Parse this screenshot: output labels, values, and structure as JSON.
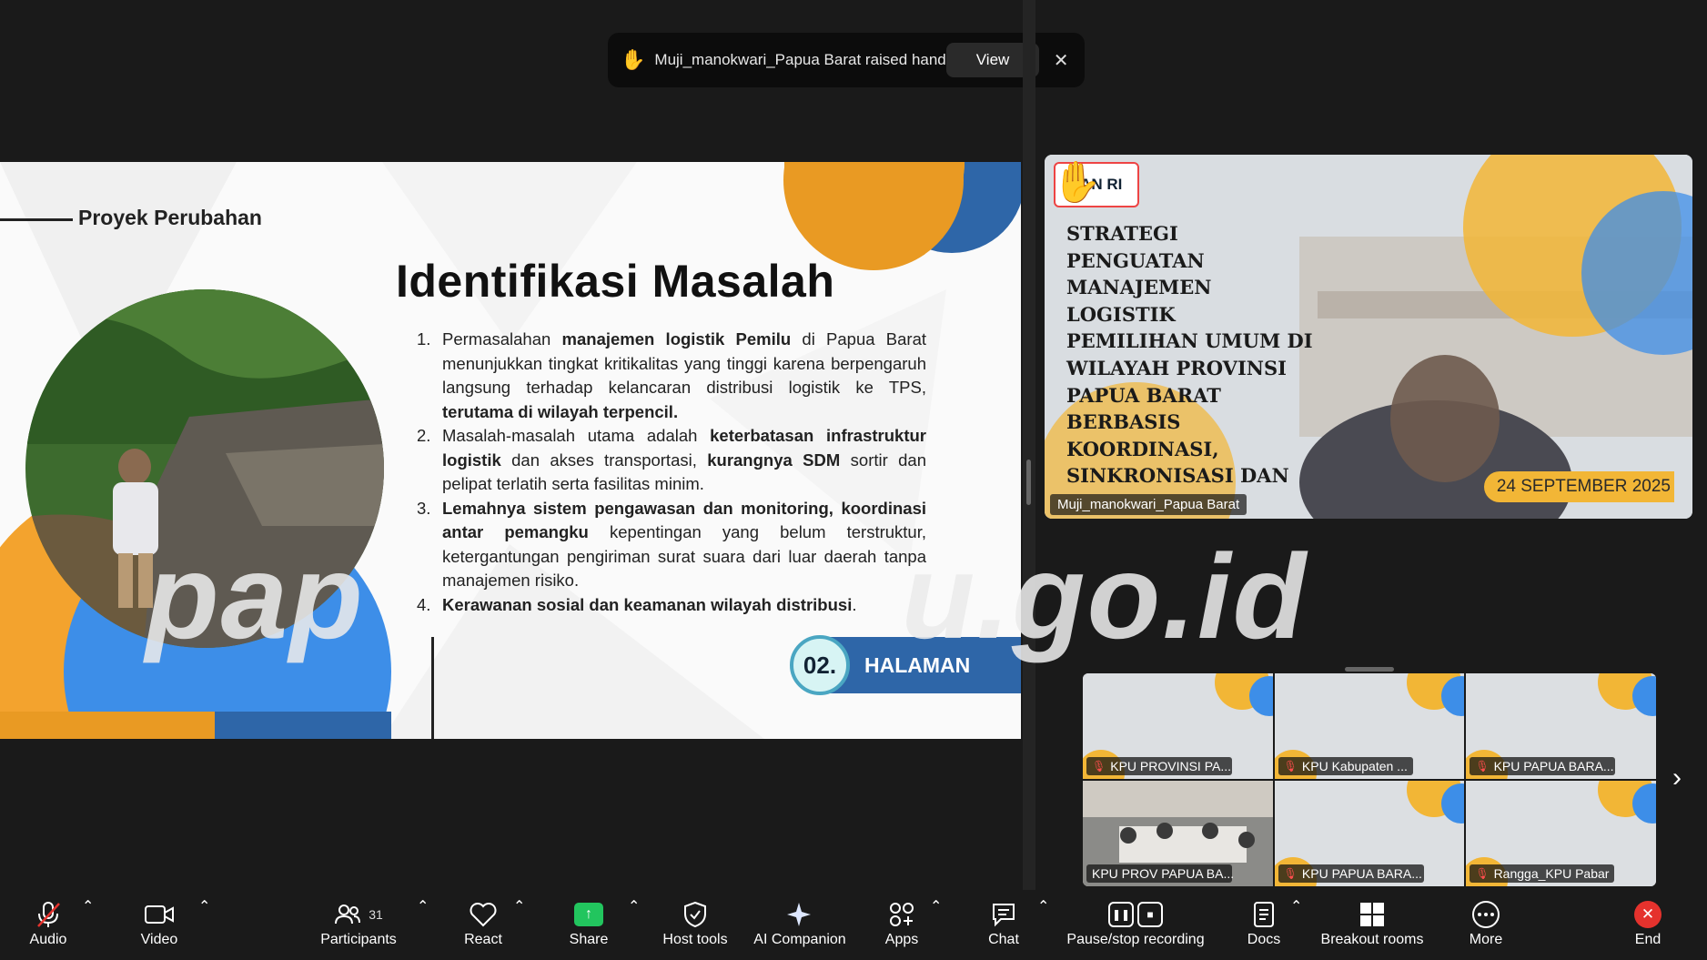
{
  "notification": {
    "message": "Muji_manokwari_Papua Barat raised hand",
    "view_label": "View",
    "close_glyph": "✕"
  },
  "slide": {
    "section_title": "Proyek Perubahan",
    "title": "Identifikasi Masalah",
    "items": [
      {
        "num": "1.",
        "html": "Permasalahan <b>manajemen logistik Pemilu</b> di Papua Barat menunjukkan tingkat kritikalitas yang tinggi karena berpengaruh langsung terhadap kelancaran distribusi logistik ke TPS, <b>terutama di wilayah terpencil.</b>"
      },
      {
        "num": "2.",
        "html": "Masalah-masalah utama adalah <b>keterbatasan infrastruktur logistik</b> dan akses transportasi, <b>kurangnya SDM</b> sortir dan pelipat terlatih serta fasilitas minim."
      },
      {
        "num": "3.",
        "html": "<b>Lemahnya sistem pengawasan dan monitoring, koordinasi antar pemangku</b> kepentingan yang belum terstruktur, ketergantungan pengiriman surat suara dari luar daerah tanpa manajemen risiko."
      },
      {
        "num": "4.",
        "html": "<b>Kerawanan sosial dan keamanan wilayah distribusi</b>."
      }
    ],
    "page_number": "02.",
    "page_label": "HALAMAN"
  },
  "watermark": {
    "left": "pap",
    "right": "u.go.id"
  },
  "speaker": {
    "logo_text": "LAN RI",
    "title_lines": [
      "STRATEGI",
      "PENGUATAN",
      "MANAJEMEN",
      "LOGISTIK",
      "PEMILIHAN UMUM DI",
      "WILAYAH PROVINSI",
      "PAPUA BARAT",
      "BERBASIS",
      "KOORDINASI,",
      "SINKRONISASI DAN"
    ],
    "date": "24 SEPTEMBER 2025",
    "name": "Muji_manokwari_Papua Barat"
  },
  "gallery": [
    {
      "name": "KPU PROVINSI PA...",
      "muted": true
    },
    {
      "name": "KPU Kabupaten ...",
      "muted": true
    },
    {
      "name": "KPU PAPUA BARA...",
      "muted": true
    },
    {
      "name": "KPU PROV PAPUA BA...",
      "muted": false
    },
    {
      "name": "KPU PAPUA BARA...",
      "muted": true
    },
    {
      "name": "Rangga_KPU Pabar",
      "muted": true
    }
  ],
  "toolbar": {
    "audio": "Audio",
    "video": "Video",
    "participants": "Participants",
    "participants_count": "31",
    "react": "React",
    "share": "Share",
    "host_tools": "Host tools",
    "ai_companion": "AI Companion",
    "apps": "Apps",
    "chat": "Chat",
    "recording": "Pause/stop recording",
    "docs": "Docs",
    "breakout": "Breakout rooms",
    "more": "More",
    "end": "End"
  },
  "colors": {
    "accent_orange": "#f3a32e",
    "accent_blue": "#3d8ee8",
    "deep_blue": "#2e66a8",
    "share_green": "#22c55e",
    "end_red": "#e5322d"
  }
}
